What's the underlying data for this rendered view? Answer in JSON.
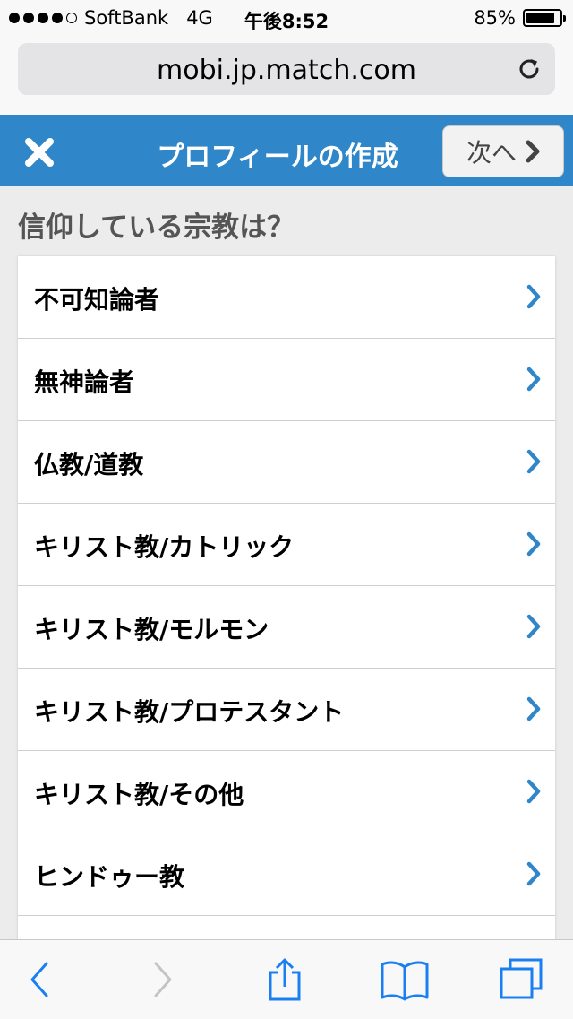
{
  "status_bar": {
    "carrier": "SoftBank",
    "network": "4G",
    "time": "午後8:52",
    "battery": "85%",
    "battery_level": 0.85
  },
  "browser": {
    "url": "mobi.jp.match.com",
    "reload_icon": "reload-icon"
  },
  "header": {
    "title": "プロフィールの作成",
    "next_label": "次へ",
    "color": "#2f86c9"
  },
  "question": "信仰している宗教は？",
  "options": [
    {
      "label": "不可知論者"
    },
    {
      "label": "無神論者"
    },
    {
      "label": "仏教/道教"
    },
    {
      "label": "キリスト教/カトリック"
    },
    {
      "label": "キリスト教/モルモン"
    },
    {
      "label": "キリスト教/プロテスタント"
    },
    {
      "label": "キリスト教/その他"
    },
    {
      "label": "ヒンドゥー教"
    },
    {
      "label": ""
    }
  ],
  "toolbar": {
    "icons": [
      "back-icon",
      "forward-icon",
      "share-icon",
      "bookmarks-icon",
      "tabs-icon"
    ],
    "accent": "#1a7ff0"
  }
}
